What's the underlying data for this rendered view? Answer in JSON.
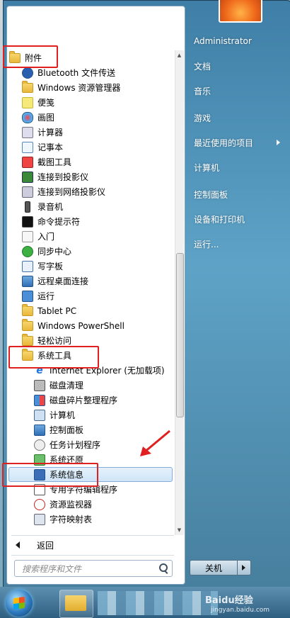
{
  "left_programs": [
    {
      "label": "附件",
      "icon": "folder-icon"
    },
    {
      "label": "Bluetooth 文件传送",
      "icon": "bluetooth-icon"
    },
    {
      "label": "Windows 资源管理器",
      "icon": "explorer-icon"
    },
    {
      "label": "便笺",
      "icon": "sticky-notes-icon"
    },
    {
      "label": "画图",
      "icon": "paint-icon"
    },
    {
      "label": "计算器",
      "icon": "calculator-icon"
    },
    {
      "label": "记事本",
      "icon": "notepad-icon"
    },
    {
      "label": "截图工具",
      "icon": "snipping-tool-icon"
    },
    {
      "label": "连接到投影仪",
      "icon": "projector-icon"
    },
    {
      "label": "连接到网络投影仪",
      "icon": "network-projector-icon"
    },
    {
      "label": "录音机",
      "icon": "sound-recorder-icon"
    },
    {
      "label": "命令提示符",
      "icon": "command-prompt-icon"
    },
    {
      "label": "入门",
      "icon": "getting-started-icon"
    },
    {
      "label": "同步中心",
      "icon": "sync-center-icon"
    },
    {
      "label": "写字板",
      "icon": "wordpad-icon"
    },
    {
      "label": "远程桌面连接",
      "icon": "remote-desktop-icon"
    },
    {
      "label": "运行",
      "icon": "run-icon"
    },
    {
      "label": "Tablet PC",
      "icon": "folder-icon"
    },
    {
      "label": "Windows PowerShell",
      "icon": "folder-icon"
    },
    {
      "label": "轻松访问",
      "icon": "folder-icon"
    },
    {
      "label": "系统工具",
      "icon": "folder-icon"
    },
    {
      "label": "Internet Explorer (无加载项)",
      "icon": "internet-explorer-icon"
    },
    {
      "label": "磁盘清理",
      "icon": "disk-cleanup-icon"
    },
    {
      "label": "磁盘碎片整理程序",
      "icon": "defragment-icon"
    },
    {
      "label": "计算机",
      "icon": "computer-icon"
    },
    {
      "label": "控制面板",
      "icon": "control-panel-icon"
    },
    {
      "label": "任务计划程序",
      "icon": "task-scheduler-icon"
    },
    {
      "label": "系统还原",
      "icon": "system-restore-icon"
    },
    {
      "label": "系统信息",
      "icon": "system-info-icon"
    },
    {
      "label": "专用字符编辑程序",
      "icon": "private-char-editor-icon"
    },
    {
      "label": "资源监视器",
      "icon": "resource-monitor-icon"
    },
    {
      "label": "字符映射表",
      "icon": "character-map-icon"
    }
  ],
  "back_label": "返回",
  "search_placeholder": "搜索程序和文件",
  "right_items": [
    "Administrator",
    "文档",
    "音乐",
    "游戏",
    "最近使用的项目",
    "计算机",
    "控制面板",
    "设备和打印机",
    "运行..."
  ],
  "shutdown_label": "关机",
  "watermark": "Baidu经验",
  "watermark_url": "jingyan.baidu.com"
}
